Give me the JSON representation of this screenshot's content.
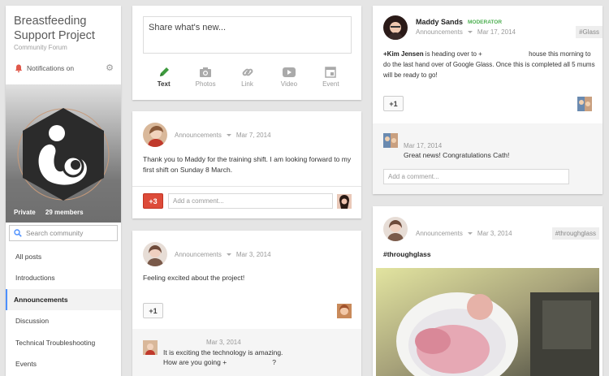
{
  "community": {
    "name": "Breastfeeding Support Project",
    "type": "Community Forum",
    "notifications": "Notifications on",
    "privacy": "Private",
    "members": "29 members",
    "search_placeholder": "Search community",
    "nav": [
      "All posts",
      "Introductions",
      "Announcements",
      "Discussion",
      "Technical Troubleshooting",
      "Events"
    ]
  },
  "share": {
    "placeholder": "Share what's new...",
    "options": [
      "Text",
      "Photos",
      "Link",
      "Video",
      "Event"
    ]
  },
  "post1": {
    "category": "Announcements",
    "date": "Mar 7, 2014",
    "text": "Thank you to Maddy for the training shift.  I am looking forward to my first shift on Sunday 8 March.",
    "plus": "+3",
    "comment_placeholder": "Add a comment..."
  },
  "post2": {
    "category": "Announcements",
    "date": "Mar 3, 2014",
    "text": "Feeling excited about the project!",
    "plus": "+1",
    "comment_date": "Mar 3, 2014",
    "comment_line1": "It is exciting the technology is amazing.",
    "comment_line2_a": "How are you going +",
    "comment_line2_b": "?"
  },
  "post3": {
    "author": "Maddy Sands",
    "role": "MODERATOR",
    "category": "Announcements",
    "date": "Mar 17, 2014",
    "tag": "#Glass",
    "mention": "+Kim Jensen",
    "text_a": " is heading over to +",
    "text_b": " house this morning to do the last hand over of Google Glass. Once this is completed all 5 mums will be ready to go!",
    "plus": "+1",
    "comment_date": "Mar 17, 2014",
    "comment_text": "Great news! Congratulations Cath!",
    "comment_placeholder": "Add a comment..."
  },
  "post4": {
    "category": "Announcements",
    "date": "Mar 3, 2014",
    "tag": "#throughglass",
    "text": "#throughglass"
  },
  "colors": {
    "accent": "#4d90fe",
    "plus_red": "#dd4b39",
    "moderator": "#4caf50",
    "text_green": "#3e9a3e"
  }
}
